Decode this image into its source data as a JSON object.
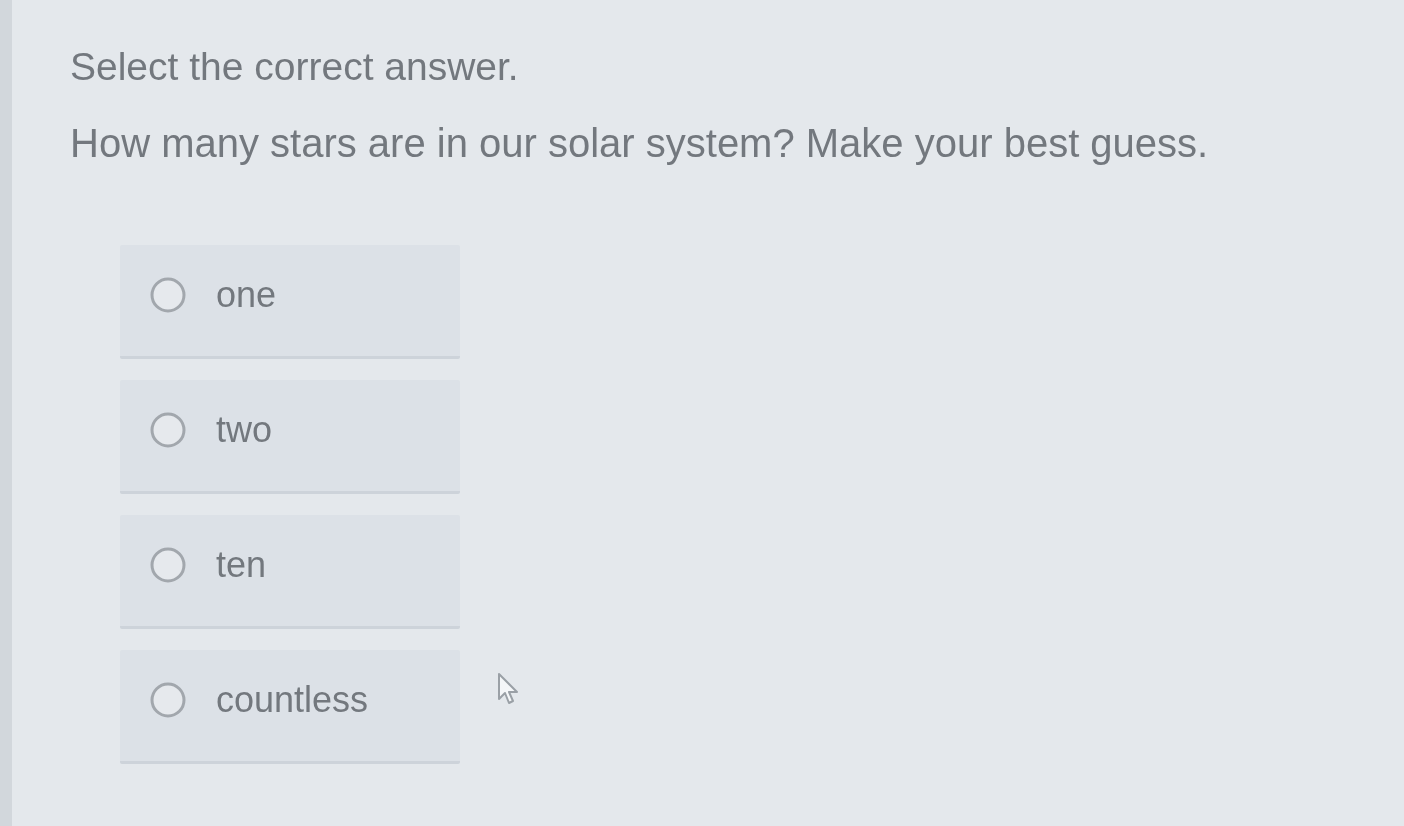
{
  "instruction": "Select the correct answer.",
  "question": "How many stars are in our solar system? Make your best guess.",
  "options": [
    {
      "label": "one",
      "selected": false
    },
    {
      "label": "two",
      "selected": false
    },
    {
      "label": "ten",
      "selected": false
    },
    {
      "label": "countless",
      "selected": false
    }
  ]
}
